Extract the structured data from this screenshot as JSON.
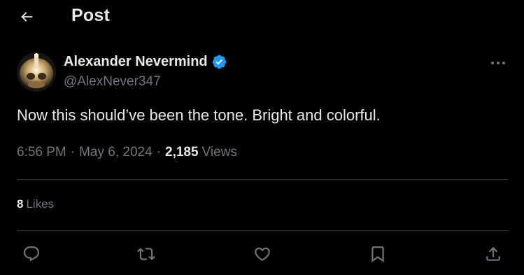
{
  "header": {
    "title": "Post",
    "back_icon": "arrow-left-icon"
  },
  "tweet": {
    "author_name": "Alexander Nevermind",
    "author_handle": "@AlexNever347",
    "verified": true,
    "text": "Now this should’ve been the tone. Bright and colorful.",
    "time": "6:56 PM",
    "separator": "·",
    "date": "May 6, 2024",
    "views_count": "2,185",
    "views_label": "Views",
    "likes_count": "8",
    "likes_label": "Likes"
  },
  "actions": [
    {
      "name": "reply",
      "icon": "reply-icon"
    },
    {
      "name": "repost",
      "icon": "repost-icon"
    },
    {
      "name": "like",
      "icon": "heart-icon"
    },
    {
      "name": "bookmark",
      "icon": "bookmark-icon"
    },
    {
      "name": "share",
      "icon": "share-icon"
    }
  ],
  "colors": {
    "background": "#000000",
    "text_primary": "#e7e9ea",
    "text_secondary": "#71767b",
    "divider": "#2f3336",
    "verified_blue": "#1d9bf0"
  }
}
